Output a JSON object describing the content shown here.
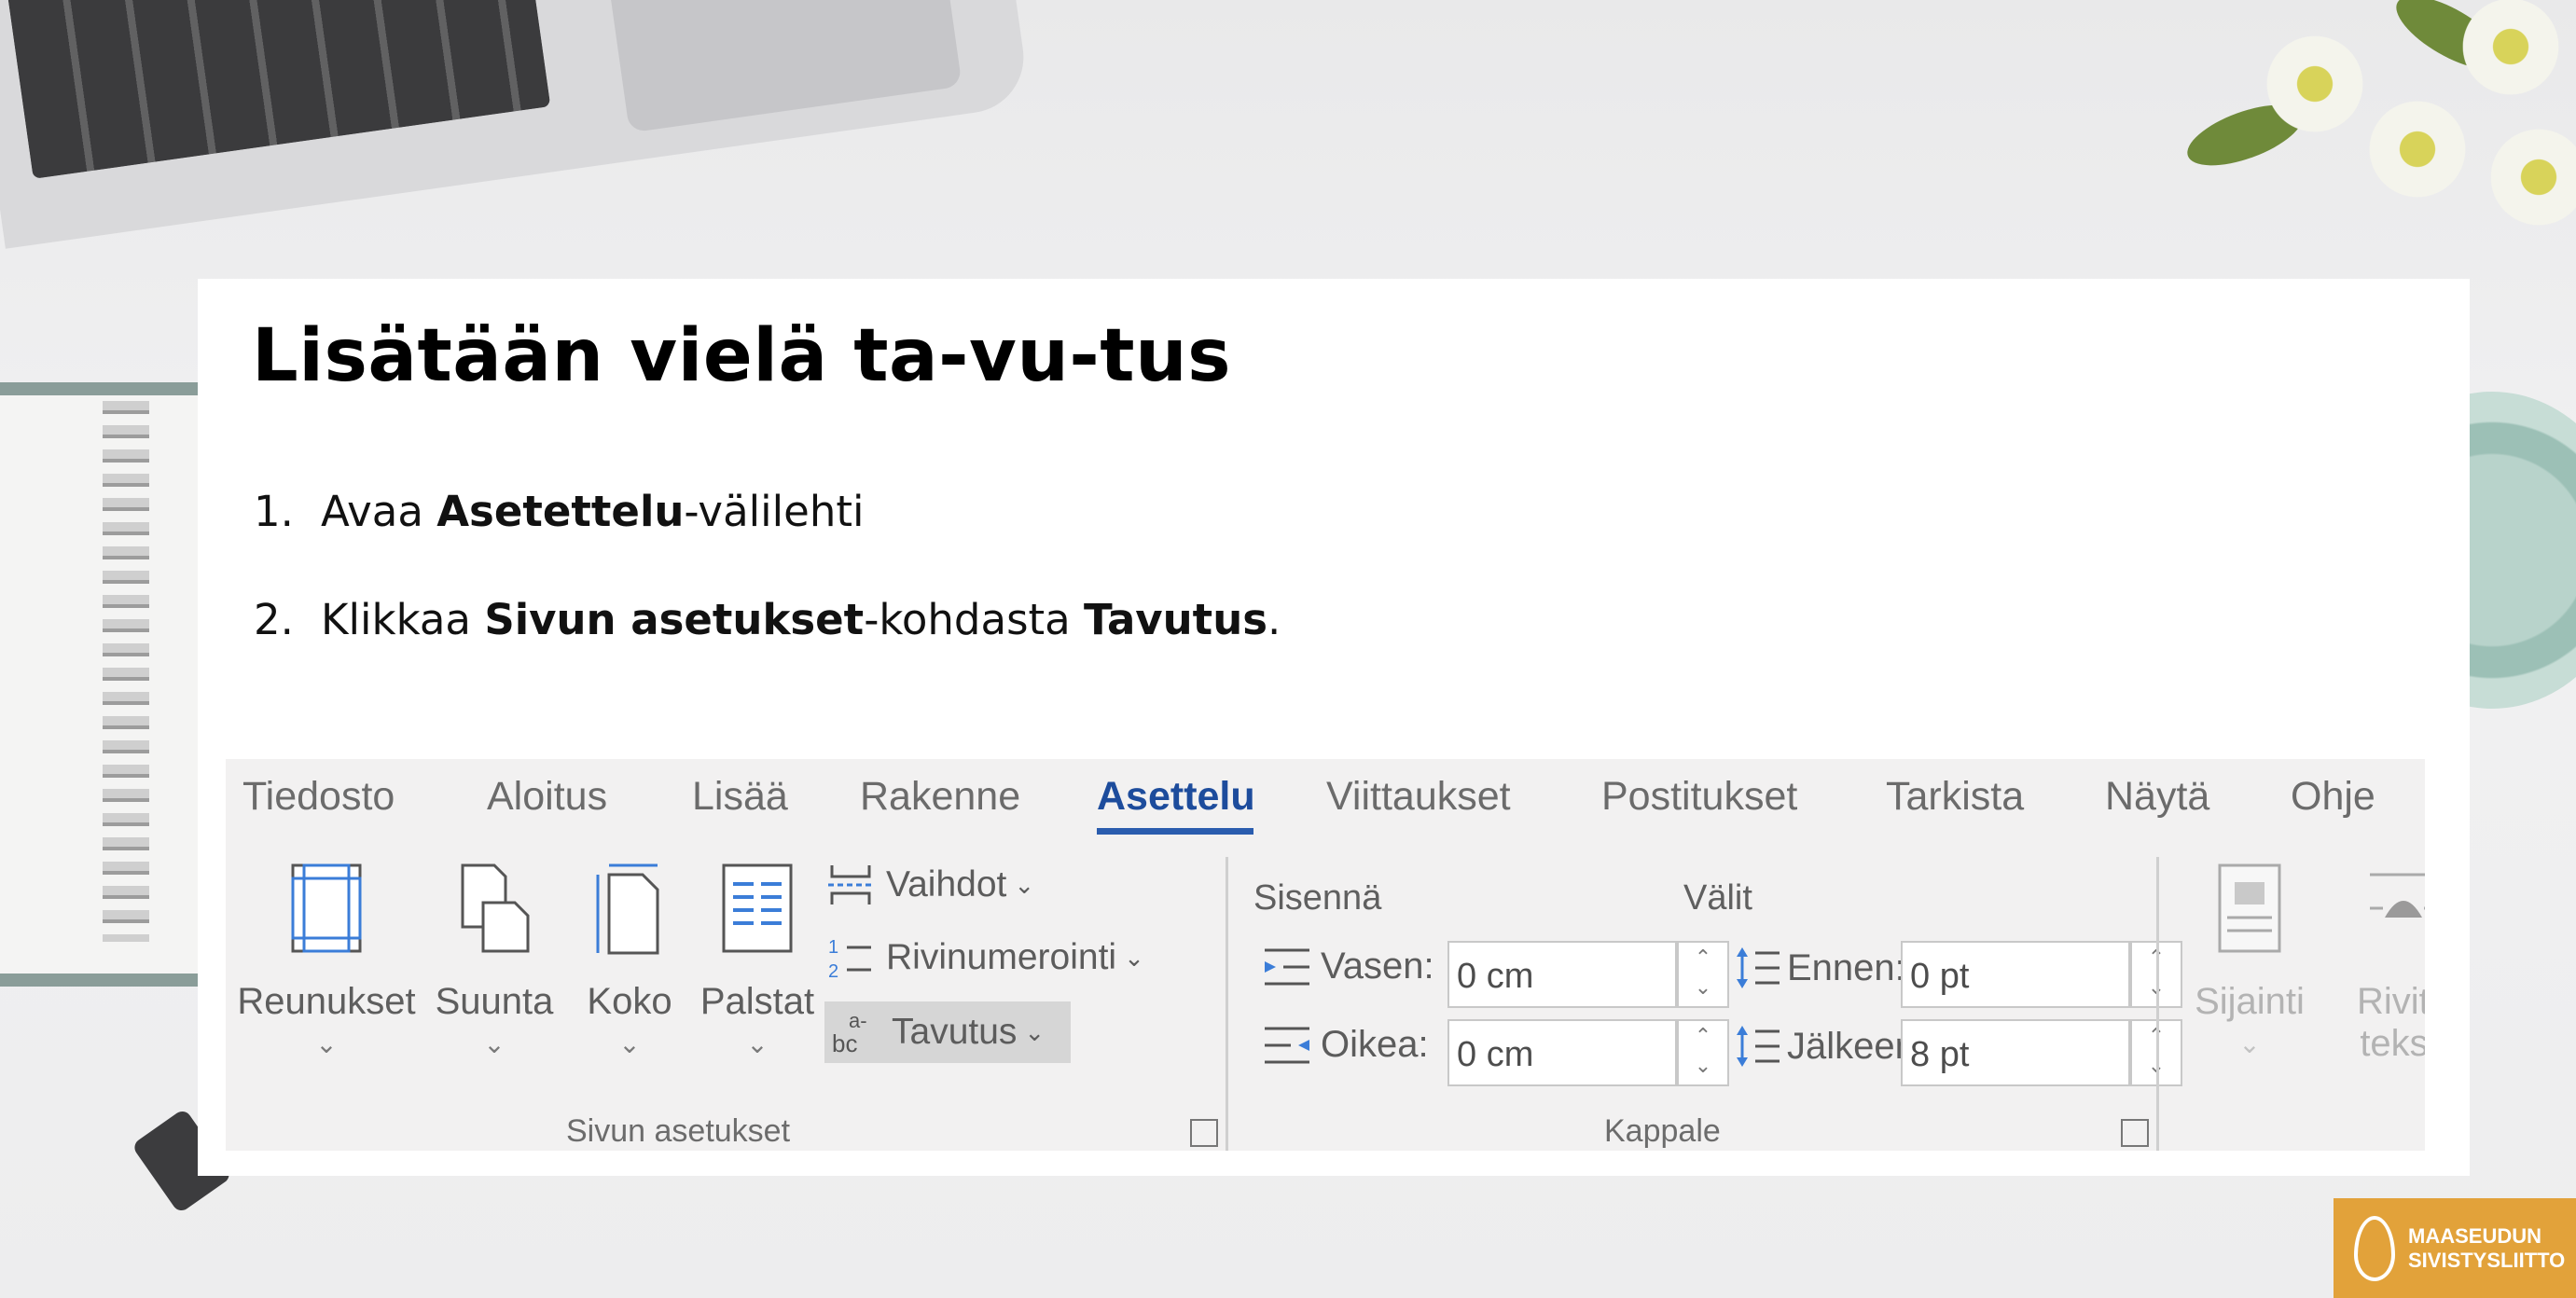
{
  "slide": {
    "title": "Lisätään vielä ta-vu-tus",
    "steps": [
      {
        "num": "1.",
        "pre": "Avaa ",
        "bold1": "Asetettelu",
        "mid": "-välilehti",
        "bold2": "",
        "post": ""
      },
      {
        "num": "2.",
        "pre": "Klikkaa ",
        "bold1": "Sivun asetukset",
        "mid": "-kohdasta ",
        "bold2": "Tavutus",
        "post": "."
      }
    ]
  },
  "ribbon": {
    "tabs": [
      "Tiedosto",
      "Aloitus",
      "Lisää",
      "Rakenne",
      "Asettelu",
      "Viittaukset",
      "Postitukset",
      "Tarkista",
      "Näytä",
      "Ohje"
    ],
    "active_tab": "Asettelu",
    "page_setup": {
      "buttons": [
        "Reunukset",
        "Suunta",
        "Koko",
        "Palstat"
      ],
      "small_buttons": [
        "Vaihdot",
        "Rivinumerointi",
        "Tavutus"
      ],
      "group_label": "Sivun asetukset"
    },
    "paragraph": {
      "indent_label": "Sisennä",
      "spacing_label": "Välit",
      "left_label": "Vasen:",
      "left_value": "0 cm",
      "right_label": "Oikea:",
      "right_value": "0 cm",
      "before_label": "Ennen:",
      "before_value": "0 pt",
      "after_label": "Jälkeen:",
      "after_value": "8 pt",
      "group_label": "Kappale"
    },
    "arrange": {
      "position_label": "Sijainti",
      "wrap_label_1": "Rivitä",
      "wrap_label_2": "teksti"
    },
    "chevron": "⌄",
    "accent_color": "#2a5cae"
  },
  "logo": {
    "line1": "MAASEUDUN",
    "line2": "SIVISTYSLIITTO",
    "color": "#e2a23a"
  }
}
